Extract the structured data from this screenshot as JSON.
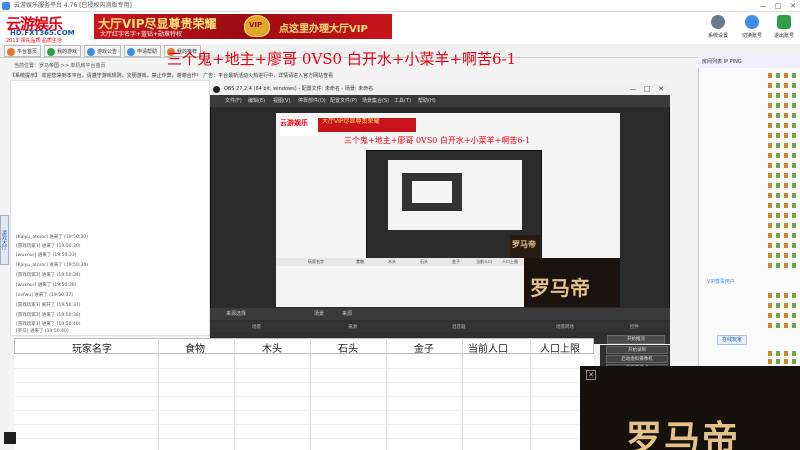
{
  "window": {
    "title": "云游娱乐服务平台 4.76 [已授权内测版专用]",
    "min": "—",
    "max": "□",
    "close": "✕"
  },
  "logo": {
    "line1": "云游娱乐",
    "line2": "HD.FXT365.COM",
    "line3": "2013 领先品质 品质生活"
  },
  "banner": {
    "vip_title": "大厅VIP尽显尊贵荣耀",
    "vip_sub": "大厅红字名字+蓝钻+勋章特权",
    "cta": "点这里办理大厅VIP"
  },
  "top_icons": [
    {
      "label": "系统设置"
    },
    {
      "label": "切换账号"
    },
    {
      "label": "退出账号"
    }
  ],
  "nav_tabs": [
    {
      "label": "平台首页",
      "color": "#e6742b"
    },
    {
      "label": "我的游戏",
      "color": "#2f9e44"
    },
    {
      "label": "游戏公告",
      "color": "#3a8ee6"
    },
    {
      "label": "申请帮助",
      "color": "#3a8ee6"
    },
    {
      "label": "我的推荐",
      "color": "#e6742b"
    }
  ],
  "headline": "三个鬼+地主+廖哥 0VS0 白开水+小菜羊+啊苦6-1",
  "path_text": "当前位置：罗马帝国  >>  单机房平台首页",
  "notice_text": "【系统提示】 欢迎您来到本平台，请遵守游戏规则，文明游戏，禁止作弊，谢谢合作！ 广告：平台最新活动火热进行中，详情请进入官方网站查看",
  "chat_lines": [
    "[Kaiyu_atoror] 进来了 (19:50:30)",
    "[游戏玩家1] 进来了 (19:50:30)",
    "[wuxnur] 进来了 (19:50:33)",
    "[Kaiyu_atoror] 进来了 (19:50:34)",
    "[游戏玩家2] 进来了 (19:50:34)",
    "[wuxnur] 进来了 (19:50:36)",
    "[xxfwu] 进来了 (19:50:37)",
    "[游戏玩家3] 离开了 (19:50:37)",
    "[游戏玩家2] 进来了 (19:50:38)",
    "[游戏玩家1] 进来了 (19:50:40)",
    "[罗马] 进来了 (19:50:40)",
    "[Kaiyu] 进来了 (19:50:41)"
  ],
  "side_tab": "游戏大厅",
  "right_panel": {
    "header": "房间列表  IP PING",
    "status": "VIP尊贵用户",
    "online": "在线玩家"
  },
  "obs": {
    "title": "OBS 27.2.4 (64 bit, windows) - 配置文件: 未命名 - 场景: 未命名",
    "menu": [
      "文件(F)",
      "编辑(E)",
      "视图(V)",
      "停靠部件(D)",
      "配置文件(P)",
      "场景集合(S)",
      "工具(T)",
      "帮助(H)"
    ],
    "lower_tabs": [
      "来源选择",
      "场景",
      "来源"
    ],
    "col_heads": [
      "场景",
      "来源",
      "混音器",
      "场景转场",
      "控件"
    ],
    "dock_btn": "开始推流",
    "mini_btns": [
      "开始录制",
      "启动虚拟摄像机",
      "工作室模式"
    ]
  },
  "capture": {
    "logo": "云游娱乐",
    "banner": "大厅VIP尽显尊贵荣耀",
    "title": "三个鬼+地主+廖哥 0VS0 白开水+小菜羊+啊苦6-1",
    "roma_small": "罗马帝",
    "roma_corner": "罗马帝",
    "table_cols": [
      "玩家名字",
      "食物",
      "木头",
      "石头",
      "金子",
      "当前人口",
      "人口上限"
    ]
  },
  "table": {
    "columns": [
      "玩家名字",
      "食物",
      "木头",
      "石头",
      "金子",
      "当前人口",
      "人口上限"
    ]
  },
  "roma_overlay": {
    "text": "罗马帝",
    "close": "✕"
  }
}
